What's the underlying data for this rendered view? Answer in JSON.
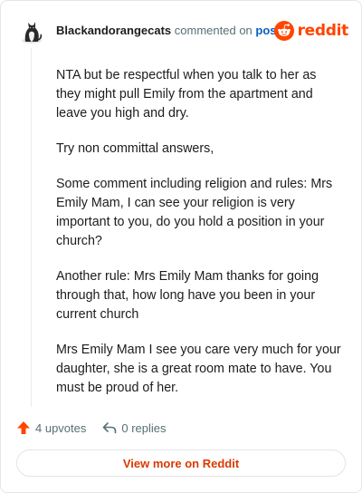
{
  "header": {
    "username": "Blackandorangecats",
    "commented_text": "commented on",
    "post_link": "post",
    "brand": "reddit"
  },
  "comment": {
    "paragraphs": [
      "NTA but be respectful when you talk to her as they might pull Emily from the apartment and leave you high and dry.",
      "Try non committal answers,",
      "Some comment including religion and rules: Mrs Emily Mam, I can see your religion is very important to you, do you hold a position in your church?",
      "Another rule: Mrs Emily Mam thanks for going through that, how long have you been in your current church",
      "Mrs Emily Mam I see you care very much for your daughter, she is a great room mate to have. You must be proud of her."
    ]
  },
  "actions": {
    "upvotes": "4 upvotes",
    "replies": "0 replies"
  },
  "footer": {
    "view_more": "View more on Reddit"
  },
  "colors": {
    "brand": "#ff4500",
    "link": "#0a5ec4",
    "cta": "#d93a00",
    "muted": "#576f76"
  }
}
